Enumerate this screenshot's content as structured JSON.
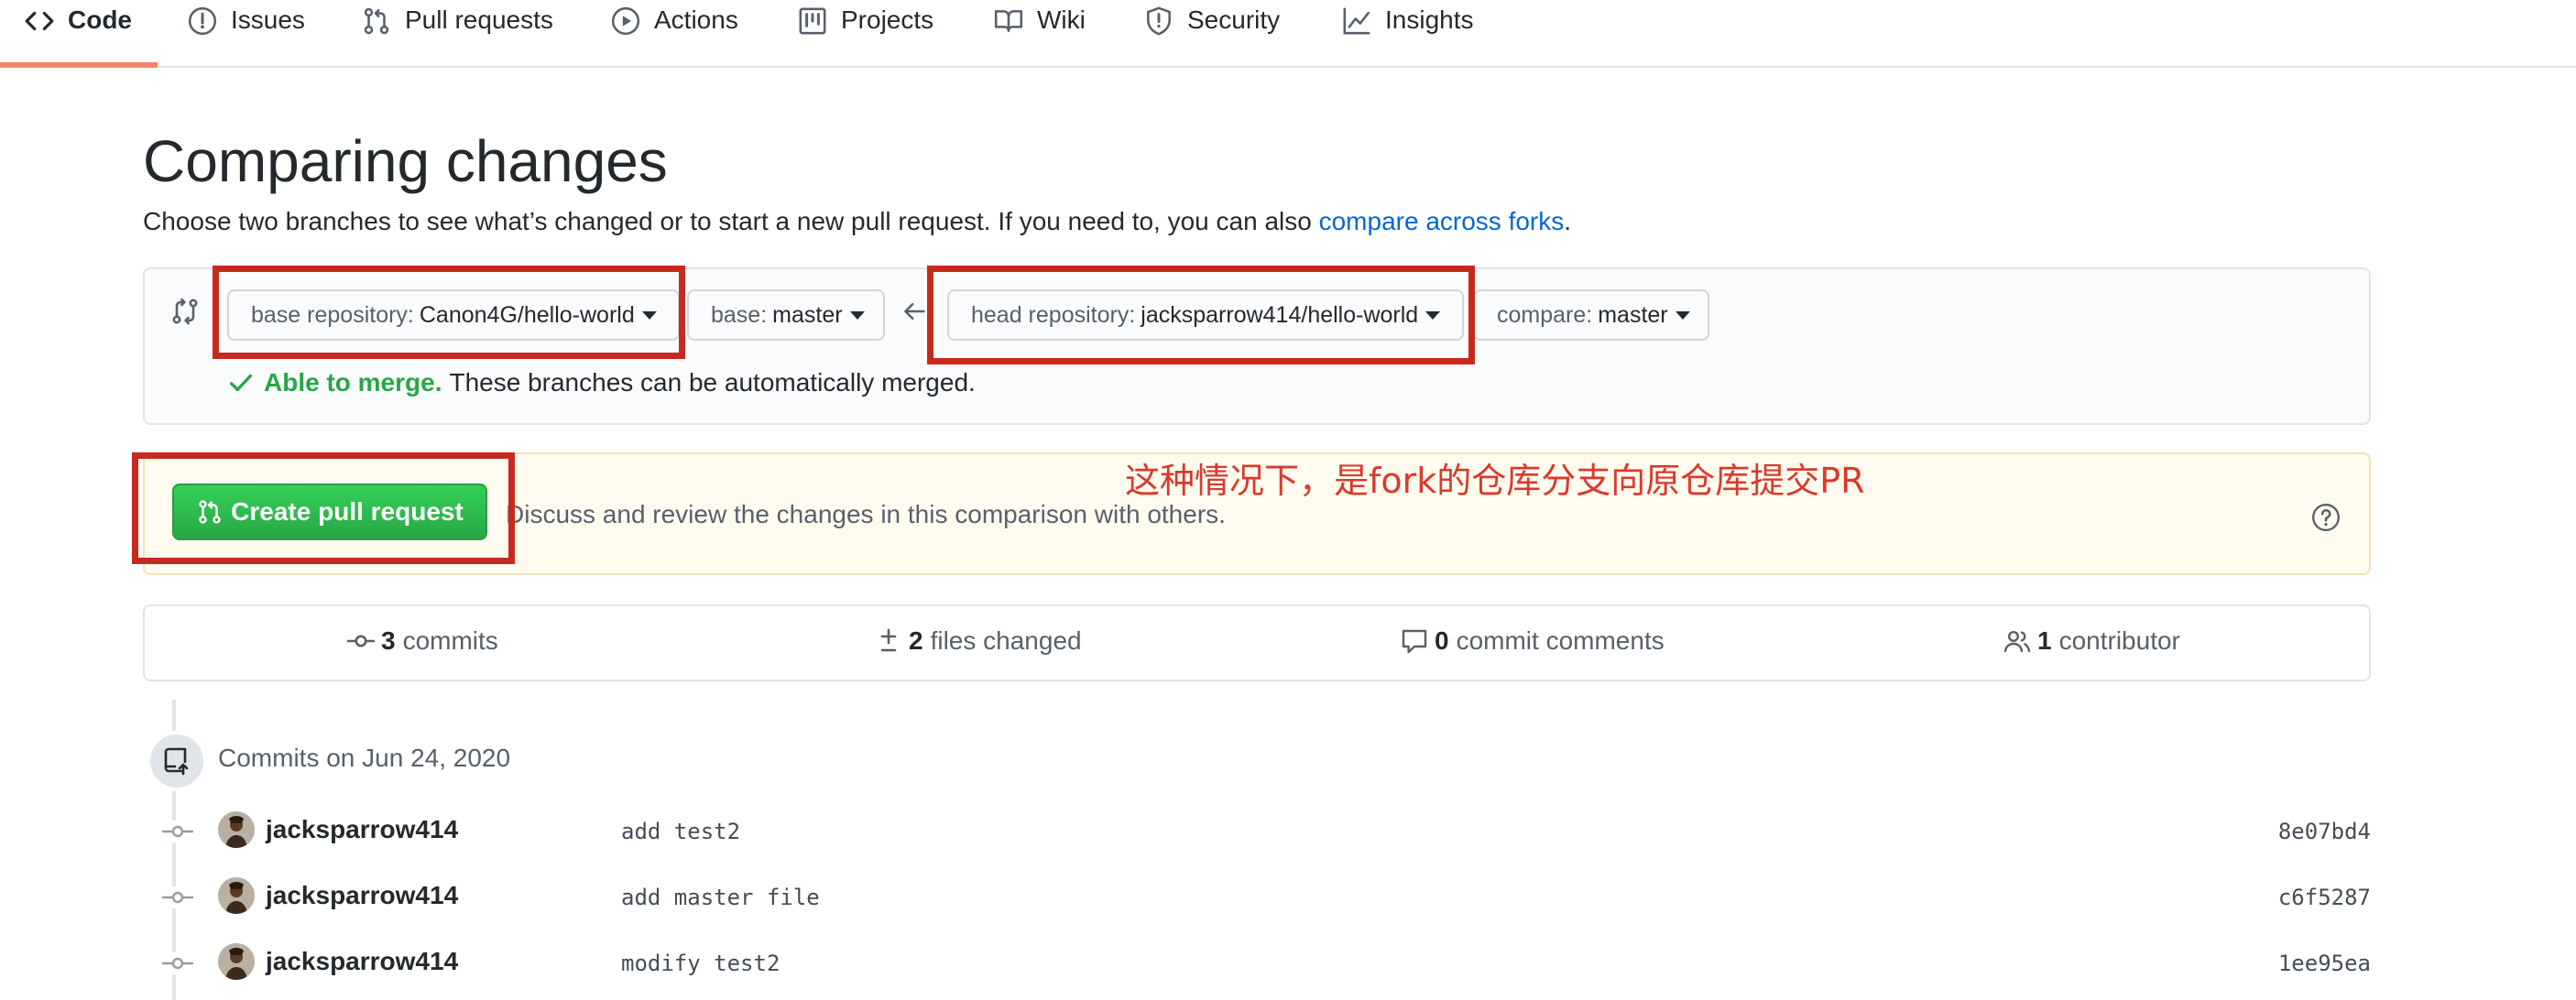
{
  "repo_nav": {
    "items": [
      {
        "label": "Code",
        "icon": "code-icon",
        "selected": true
      },
      {
        "label": "Issues",
        "icon": "issue-icon"
      },
      {
        "label": "Pull requests",
        "icon": "git-pull-request-icon"
      },
      {
        "label": "Actions",
        "icon": "play-icon"
      },
      {
        "label": "Projects",
        "icon": "project-icon"
      },
      {
        "label": "Wiki",
        "icon": "book-icon"
      },
      {
        "label": "Security",
        "icon": "shield-icon"
      },
      {
        "label": "Insights",
        "icon": "graph-icon"
      }
    ],
    "selected_color": "#f9826c"
  },
  "page": {
    "title": "Comparing changes",
    "subtitle_text": "Choose two branches to see what’s changed or to start a new pull request. If you need to, you can also ",
    "subtitle_link": "compare across forks",
    "subtitle_end": "."
  },
  "range": {
    "base_repo_label": "base repository:",
    "base_repo_value": "Canon4G/hello-world",
    "base_label": "base:",
    "base_value": "master",
    "head_repo_label": "head repository:",
    "head_repo_value": "jacksparrow414/hello-world",
    "compare_label": "compare:",
    "compare_value": "master",
    "merge_ok": "Able to merge.",
    "merge_text": "These branches can be automatically merged.",
    "merge_color": "#28a745"
  },
  "pr": {
    "button_label": "Create pull request",
    "hint": "Discuss and review the changes in this comparison with others.",
    "button_color": "#2ea44f"
  },
  "annotation": {
    "text": "这种情况下，是fork的仓库分支向原仓库提交PR",
    "color": "#d93a2b"
  },
  "stats": {
    "commits_count": "3",
    "commits_label": "commits",
    "files_count": "2",
    "files_label": "files changed",
    "comments_count": "0",
    "comments_label": "commit comments",
    "contributors_count": "1",
    "contributors_label": "contributor"
  },
  "commits": {
    "group_label": "Commits on Jun 24, 2020",
    "rows": [
      {
        "author": "jacksparrow414",
        "message": "add test2",
        "sha": "8e07bd4"
      },
      {
        "author": "jacksparrow414",
        "message": "add master file",
        "sha": "c6f5287"
      },
      {
        "author": "jacksparrow414",
        "message": "modify test2",
        "sha": "1ee95ea"
      }
    ]
  }
}
